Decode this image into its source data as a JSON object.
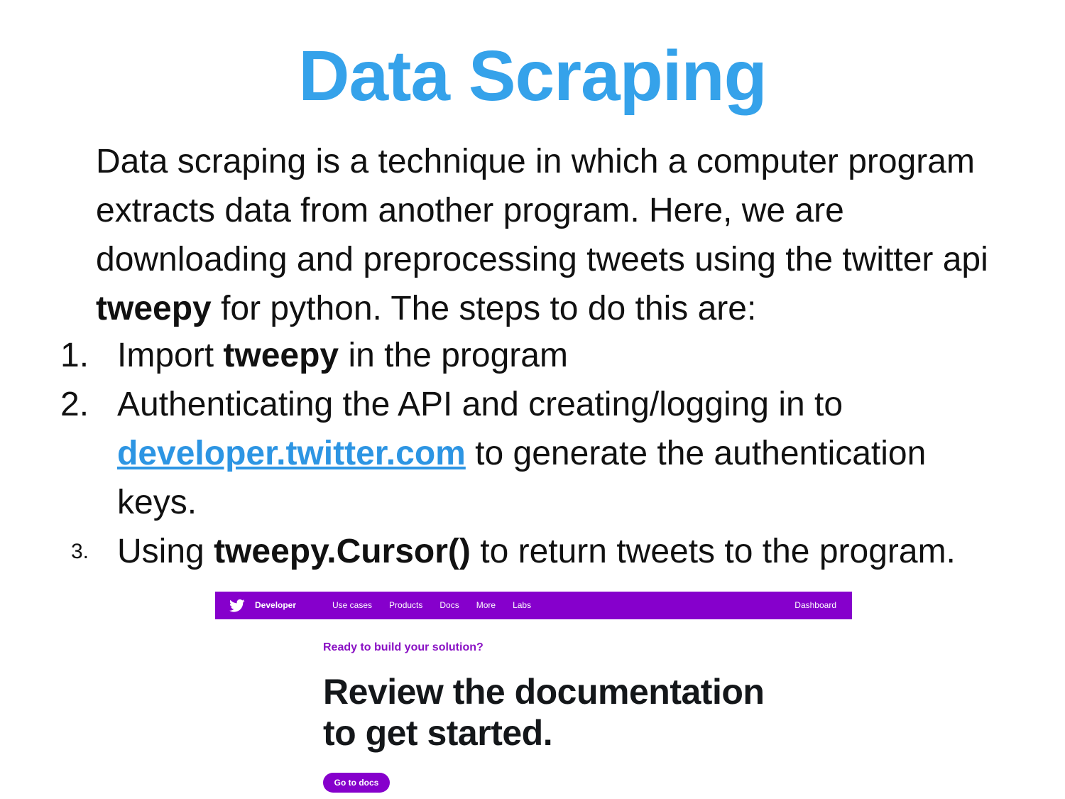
{
  "slide": {
    "title": "Data Scraping",
    "intro": {
      "part1": "Data scraping is a technique in which a computer program extracts data from another program. Here, we are downloading and preprocessing tweets using the twitter api ",
      "bold": "tweepy",
      "part2": " for python. The steps to do this are:"
    },
    "steps": [
      {
        "number": "1.",
        "before": "Import ",
        "bold": "tweepy",
        "after": " in the program"
      },
      {
        "number": "2.",
        "before": "Authenticating the API and creating/logging in to ",
        "link": "developer.twitter.com",
        "after": " to generate the authentication keys."
      },
      {
        "number": "3.",
        "before": "Using ",
        "bold": "tweepy.Cursor()",
        "after": " to return tweets to the program."
      }
    ],
    "colors": {
      "title": "#35a2ea",
      "link": "#2d95e3",
      "nav_bg": "#8600cc"
    }
  },
  "screenshot": {
    "nav": {
      "icon": "twitter-bird-icon",
      "brand": "Developer",
      "links": [
        "Use cases",
        "Products",
        "Docs",
        "More",
        "Labs"
      ],
      "dashboard": "Dashboard"
    },
    "eyebrow": "Ready to build your solution?",
    "headline_line1": "Review the documentation",
    "headline_line2": "to get started.",
    "button": "Go to docs"
  }
}
